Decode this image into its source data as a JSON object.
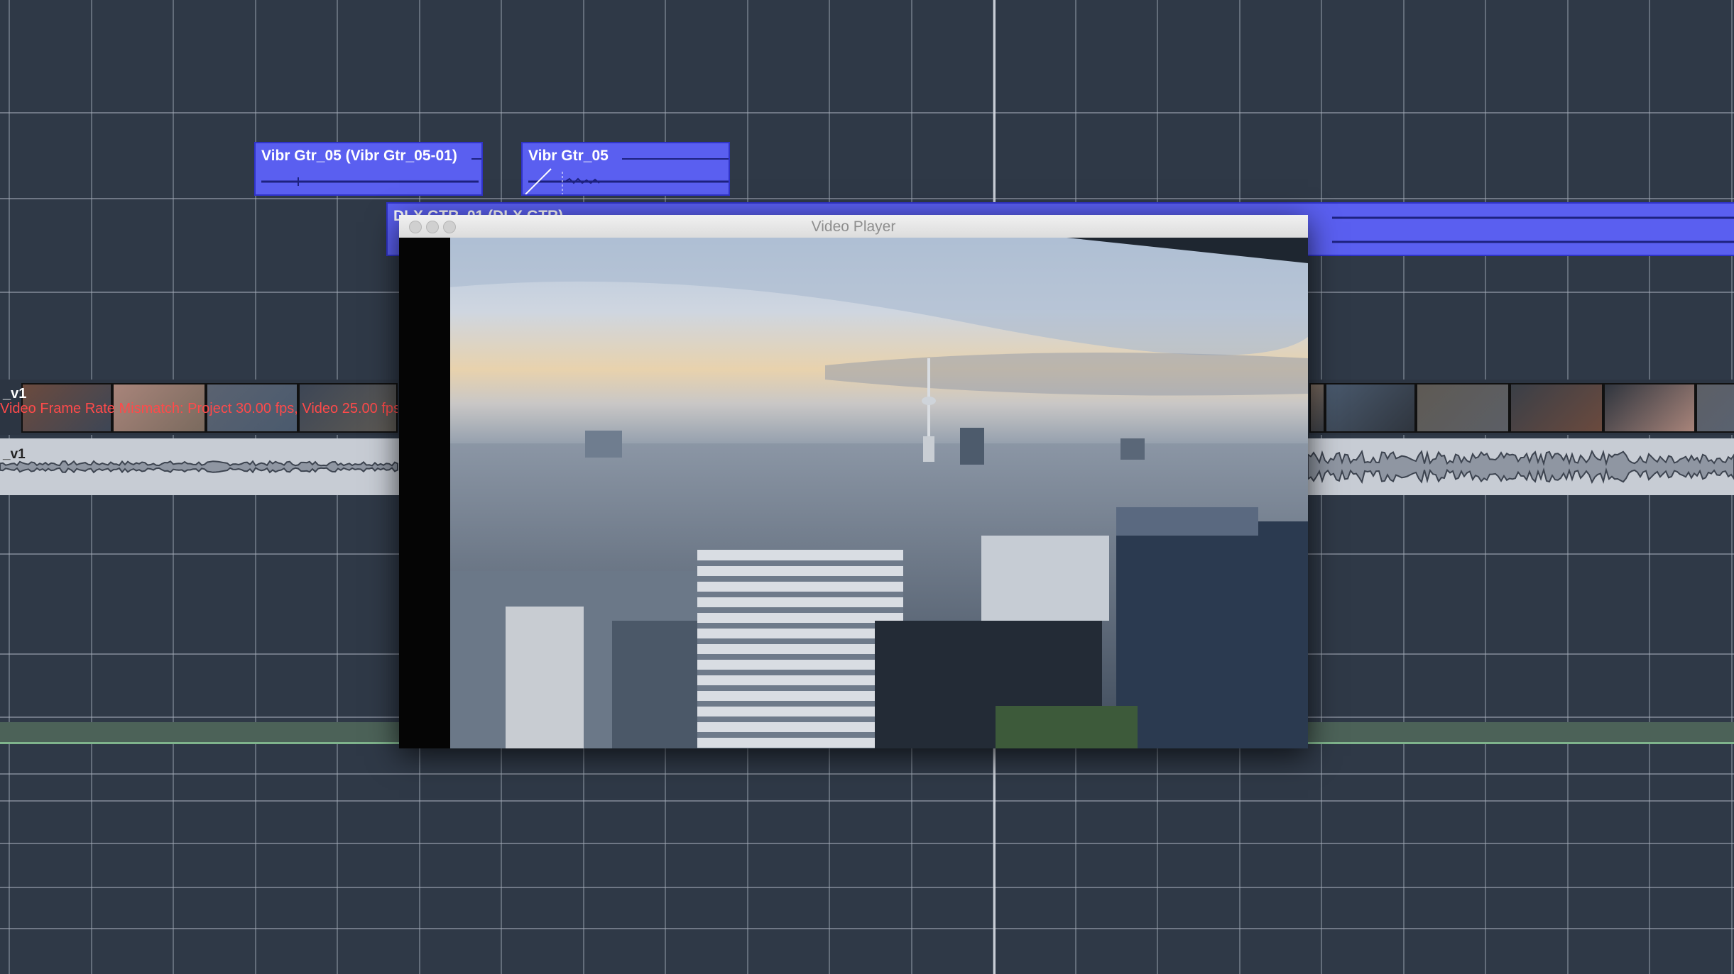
{
  "timeline": {
    "events": [
      {
        "id": "vibr1",
        "label": "Vibr Gtr_05 (Vibr Gtr_05-01)"
      },
      {
        "id": "vibr2",
        "label": "Vibr Gtr_05"
      },
      {
        "id": "dlx",
        "label": "DLX GTR_01 (DLX GTR)"
      }
    ],
    "video_track": {
      "label": "_v1",
      "mismatch_text": "Video Frame Rate Mismatch: Project 30.00 fps, Video 25.00 fps"
    },
    "audio_track": {
      "label": "_v1"
    }
  },
  "video_player": {
    "title": "Video Player"
  },
  "colors": {
    "background": "#2f3947",
    "event": "#5a5ff0",
    "mismatch": "#ff4a4a"
  }
}
